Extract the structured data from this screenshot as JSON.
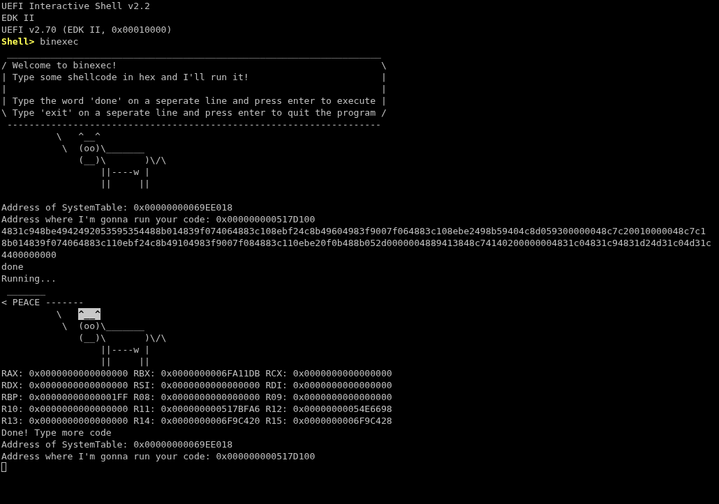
{
  "terminal": {
    "cursor_visible": true,
    "lines": [
      {
        "kind": "plain",
        "text": "UEFI Interactive Shell v2.2"
      },
      {
        "kind": "plain",
        "text": "EDK II"
      },
      {
        "kind": "plain",
        "text": "UEFI v2.70 (EDK II, 0x00010000)"
      },
      {
        "kind": "prompt",
        "prompt": "Shell>",
        "command": "binexec"
      },
      {
        "kind": "plain",
        "text": " ____________________________________________________________________"
      },
      {
        "kind": "plain",
        "text": "/ Welcome to binexec!                                                \\"
      },
      {
        "kind": "plain",
        "text": "| Type some shellcode in hex and I'll run it!                        |"
      },
      {
        "kind": "plain",
        "text": "|                                                                    |"
      },
      {
        "kind": "plain",
        "text": "| Type the word 'done' on a seperate line and press enter to execute |"
      },
      {
        "kind": "plain",
        "text": "\\ Type 'exit' on a seperate line and press enter to quit the program /"
      },
      {
        "kind": "plain",
        "text": " --------------------------------------------------------------------"
      },
      {
        "kind": "plain",
        "text": "          \\   ^__^"
      },
      {
        "kind": "plain",
        "text": "           \\  (oo)\\_______"
      },
      {
        "kind": "plain",
        "text": "              (__)\\       )\\/\\"
      },
      {
        "kind": "plain",
        "text": "                  ||----w |"
      },
      {
        "kind": "plain",
        "text": "                  ||     ||"
      },
      {
        "kind": "blank"
      },
      {
        "kind": "plain",
        "text": "Address of SystemTable: 0x00000000069EE018"
      },
      {
        "kind": "plain",
        "text": "Address where I'm gonna run your code: 0x000000000517D100"
      },
      {
        "kind": "plain",
        "text": "4831c948be4942492053595354488b014839f074064883c108ebf24c8b49604983f9007f064883c108ebe2498b59404c8d059300000048c7c20010000048c7c1"
      },
      {
        "kind": "plain",
        "text": "8b014839f074064883c110ebf24c8b49104983f9007f084883c110ebe20f0b488b052d0000004889413848c74140200000004831c04831c94831d24d31c04d31c"
      },
      {
        "kind": "plain",
        "text": "4400000000"
      },
      {
        "kind": "plain",
        "text": "done"
      },
      {
        "kind": "plain",
        "text": "Running..."
      },
      {
        "kind": "plain",
        "text": " _______"
      },
      {
        "kind": "plain",
        "text": "< PEACE -------"
      },
      {
        "kind": "marked",
        "text": "          \\   ",
        "marked": "^__^"
      },
      {
        "kind": "plain",
        "text": "           \\  (oo)\\_______"
      },
      {
        "kind": "plain",
        "text": "              (__)\\       )\\/\\"
      },
      {
        "kind": "plain",
        "text": "                  ||----w |"
      },
      {
        "kind": "plain",
        "text": "                  ||     ||"
      },
      {
        "kind": "plain",
        "text": "RAX: 0x0000000000000000 RBX: 0x0000000006FA11DB RCX: 0x0000000000000000"
      },
      {
        "kind": "plain",
        "text": "RDX: 0x0000000000000000 RSI: 0x0000000000000000 RDI: 0x0000000000000000"
      },
      {
        "kind": "plain",
        "text": "RBP: 0x00000000000001FF R08: 0x0000000000000000 R09: 0x0000000000000000"
      },
      {
        "kind": "plain",
        "text": "R10: 0x0000000000000000 R11: 0x000000000517BFA6 R12: 0x00000000054E6698"
      },
      {
        "kind": "plain",
        "text": "R13: 0x0000000000000000 R14: 0x0000000006F9C420 R15: 0x0000000006F9C428"
      },
      {
        "kind": "plain",
        "text": "Done! Type more code"
      },
      {
        "kind": "plain",
        "text": "Address of SystemTable: 0x00000000069EE018"
      },
      {
        "kind": "plain",
        "text": "Address where I'm gonna run your code: 0x000000000517D100"
      }
    ]
  }
}
